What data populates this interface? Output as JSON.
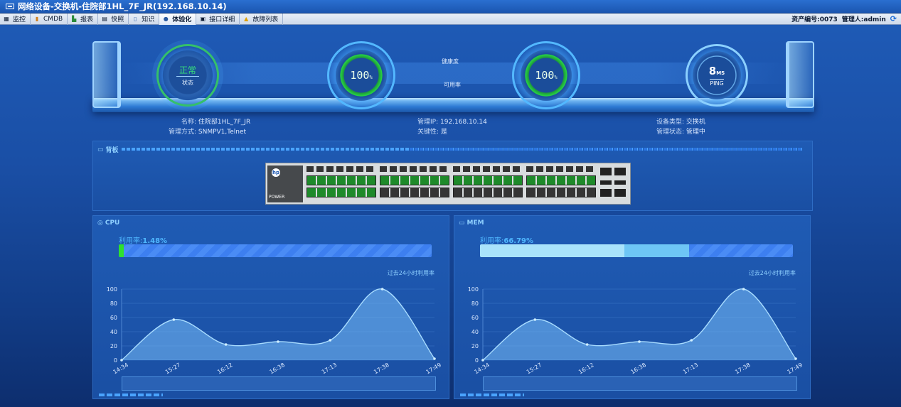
{
  "window": {
    "title": "网络设备-交换机-住院部1HL_7F_JR(192.168.10.14)"
  },
  "menu": {
    "items": [
      {
        "label": "监控",
        "icon": "monitor-icon"
      },
      {
        "label": "CMDB",
        "icon": "cmdb-icon"
      },
      {
        "label": "报表",
        "icon": "report-icon"
      },
      {
        "label": "快照",
        "icon": "snapshot-icon"
      },
      {
        "label": "知识",
        "icon": "knowledge-icon"
      },
      {
        "label": "体验化",
        "icon": "experience-icon"
      },
      {
        "label": "接口详细",
        "icon": "interface-icon"
      },
      {
        "label": "故障列表",
        "icon": "warning-icon"
      }
    ],
    "asset": "资产编号:0073",
    "manager": "管理人:admin"
  },
  "gauges": {
    "status_value": "正常",
    "status_label": "状态",
    "health_value": "100",
    "health_unit": "%",
    "health_label": "健康度",
    "avail_value": "100",
    "avail_unit": "%",
    "avail_label": "可用率",
    "ping_value": "8",
    "ping_unit": "MS",
    "ping_label": "PING"
  },
  "info": {
    "name_k": "名称:",
    "name_v": "住院部1HL_7F_JR",
    "mode_k": "管理方式:",
    "mode_v": "SNMPV1,Telnet",
    "ip_k": "管理IP:",
    "ip_v": "192.168.10.14",
    "crit_k": "关键性:",
    "crit_v": "是",
    "type_k": "设备类型:",
    "type_v": "交换机",
    "state_k": "管理状态:",
    "state_v": "管理中"
  },
  "backplane": {
    "title": "背板",
    "power": "POWER"
  },
  "cpu": {
    "title": "CPU",
    "util_label": "利用率:",
    "util_value": "1.48%",
    "past": "过去24小时利用率"
  },
  "mem": {
    "title": "MEM",
    "util_label": "利用率:",
    "util_value": "66.79%",
    "past": "过去24小时利用率"
  },
  "chart_data": [
    {
      "type": "area",
      "title": "CPU",
      "x": [
        "14:34",
        "15:27",
        "16:12",
        "16:38",
        "17:13",
        "17:38",
        "17:49"
      ],
      "y": [
        0,
        57,
        22,
        26,
        28,
        100,
        2
      ],
      "ylim": [
        0,
        100
      ],
      "yticks": [
        0,
        20,
        40,
        60,
        80,
        100
      ]
    },
    {
      "type": "area",
      "title": "MEM",
      "x": [
        "14:34",
        "15:27",
        "16:12",
        "16:38",
        "17:13",
        "17:38",
        "17:49"
      ],
      "y": [
        0,
        57,
        22,
        26,
        28,
        100,
        2
      ],
      "ylim": [
        0,
        100
      ],
      "yticks": [
        0,
        20,
        40,
        60,
        80,
        100
      ]
    }
  ]
}
